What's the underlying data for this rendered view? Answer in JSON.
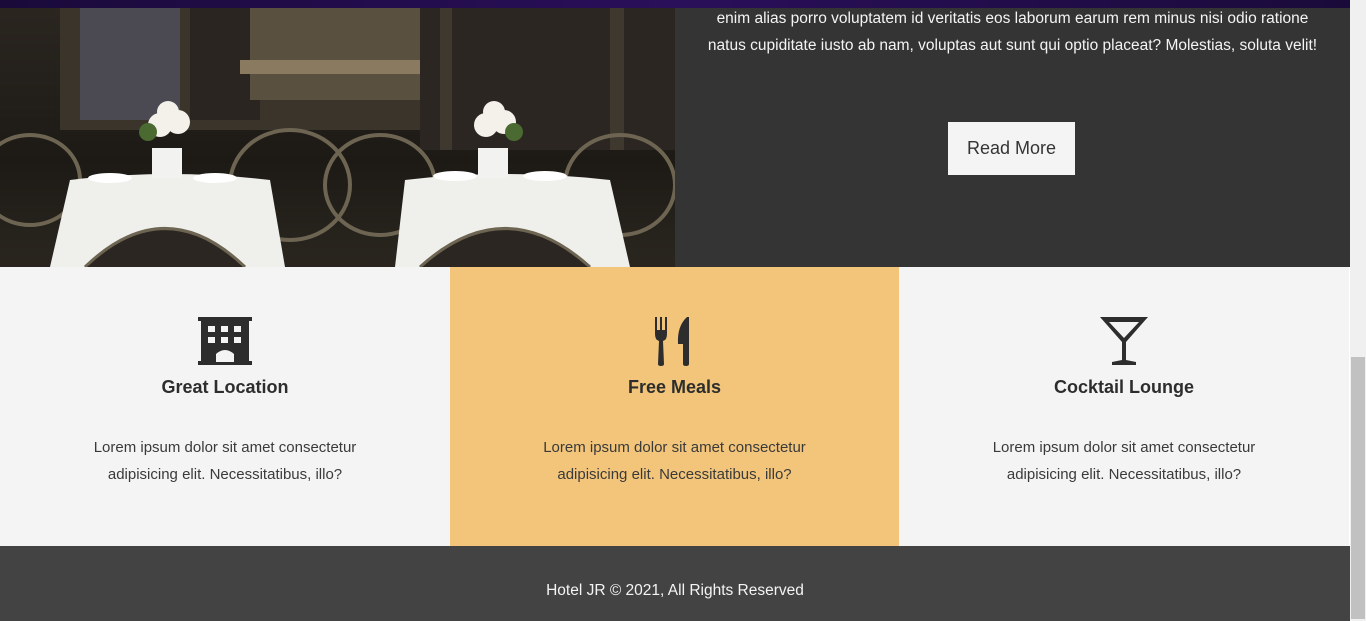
{
  "hero": {
    "paragraph": "enim alias porro voluptatem id veritatis eos laborum earum rem minus nisi odio ratione natus cupiditate iusto ab nam, voluptas aut sunt qui optio placeat? Molestias, soluta velit!",
    "read_more_label": "Read More"
  },
  "features": [
    {
      "icon": "building-icon",
      "title": "Great Location",
      "description": "Lorem ipsum dolor sit amet consectetur adipisicing elit. Necessitatibus, illo?"
    },
    {
      "icon": "utensils-icon",
      "title": "Free Meals",
      "description": "Lorem ipsum dolor sit amet consectetur adipisicing elit. Necessitatibus, illo?"
    },
    {
      "icon": "cocktail-icon",
      "title": "Cocktail Lounge",
      "description": "Lorem ipsum dolor sit amet consectetur adipisicing elit. Necessitatibus, illo?"
    }
  ],
  "footer": {
    "text": "Hotel JR © 2021, All Rights Reserved"
  },
  "colors": {
    "dark": "#343434",
    "light": "#f4f4f4",
    "accent": "#f2c57a",
    "footer": "#434343"
  }
}
